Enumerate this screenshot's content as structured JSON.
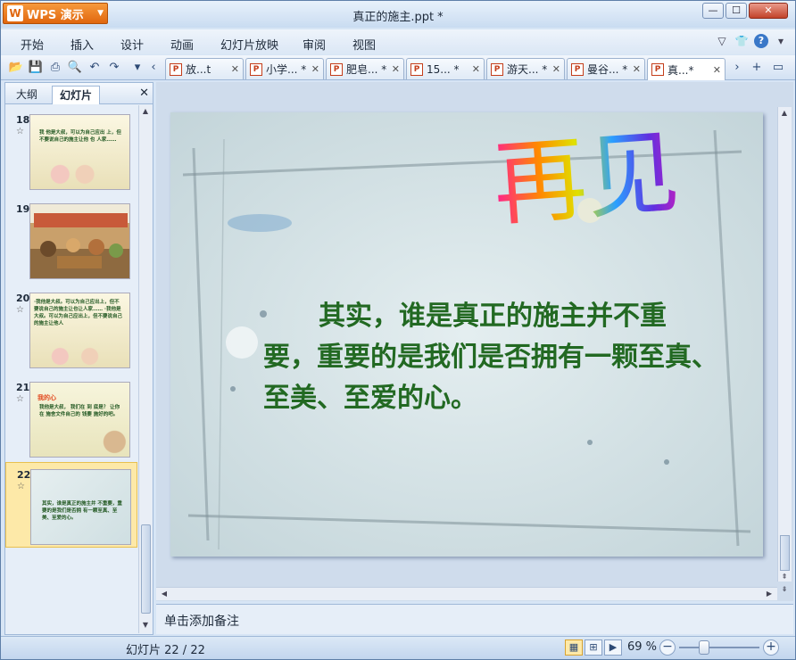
{
  "app": {
    "name": "WPS 演示",
    "logo": "W"
  },
  "window": {
    "title": "真正的施主.ppt *",
    "min": "—",
    "max": "☐",
    "close": "✕"
  },
  "menu": [
    "开始",
    "插入",
    "设计",
    "动画",
    "幻灯片放映",
    "审阅",
    "视图"
  ],
  "menu_icons": {
    "style": "衬衫",
    "help": "?"
  },
  "tabs": [
    {
      "label": "放...t",
      "active": false
    },
    {
      "label": "小学... *",
      "active": false
    },
    {
      "label": "肥皂... *",
      "active": false
    },
    {
      "label": "15... *",
      "active": false
    },
    {
      "label": "游天... *",
      "active": false
    },
    {
      "label": "曼谷... *",
      "active": false
    },
    {
      "label": "真...*",
      "active": true
    }
  ],
  "left_pane": {
    "tab_outline": "大纲",
    "tab_slides": "幻灯片",
    "close": "✕",
    "slides": [
      {
        "num": "18",
        "star": "☆",
        "thumb_text": "我 他是大叔，可以为自己应出 上，但 不要说自己的施主让他 也 人家……",
        "bg": "#f6efd6",
        "selected": false
      },
      {
        "num": "19",
        "star": "",
        "thumb_text": "",
        "bg": "#e9d9b8",
        "selected": false
      },
      {
        "num": "20",
        "star": "☆",
        "thumb_text": "·我他是大叔。可以为自己应出上，但不要说自己的施主让也让人家…… ·我他是大叔。可以为自己应出上，但不要说自己的施主让他人",
        "bg": "#f6efd6",
        "selected": false
      },
      {
        "num": "21",
        "star": "☆",
        "thumb_text": "我他是大叔， 我们在 到 底是？ 让你在 施舍文件自己的 钱要 施好的吧。",
        "title": "我的心",
        "bg": "#f3f1d2",
        "selected": false
      },
      {
        "num": "22",
        "star": "☆",
        "thumb_text": "其实，谁是真正的施主并 不重要，重要的是我们是否拥 有一颗至真、至美、至爱的心。",
        "bg": "#dde9ea",
        "selected": true
      }
    ]
  },
  "slide": {
    "title_art": "再见",
    "body": "其实，谁是真正的施主并不重要，重要的是我们是否拥有一颗至真、至美、至爱的心。"
  },
  "notes_placeholder": "单击添加备注",
  "status": {
    "slide_count": "幻灯片 22 / 22",
    "zoom": "69 %"
  },
  "colors": {
    "accent_orange": "#e0660e",
    "slide_text": "#226922",
    "selected_thumb": "#fde9a8"
  }
}
